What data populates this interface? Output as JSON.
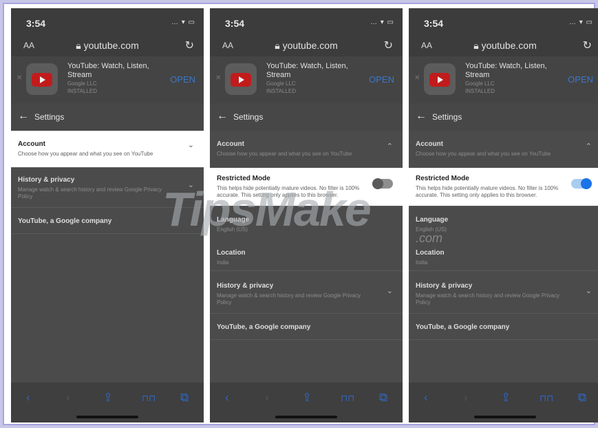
{
  "screens": [
    {
      "status": {
        "time": "3:54",
        "icons": "… ▾ ▭"
      },
      "browser": {
        "text_size": "AA",
        "url": "youtube.com",
        "reload_glyph": "↻"
      },
      "banner": {
        "title": "YouTube: Watch, Listen, Stream",
        "developer": "Google LLC",
        "status": "INSTALLED",
        "open_label": "OPEN"
      },
      "settings": {
        "back_glyph": "←",
        "title": "Settings"
      },
      "rows": {
        "account": {
          "title": "Account",
          "subtitle": "Choose how you appear and what you see on YouTube",
          "chevron": "⌄"
        },
        "history": {
          "title": "History & privacy",
          "subtitle": "Manage watch & search history and review Google Privacy Policy",
          "chevron": "⌄"
        },
        "company": {
          "title": "YouTube, a Google company"
        }
      },
      "toolbar": {
        "back": "‹",
        "forward": "›",
        "share": "⇪",
        "bookmarks": "⊓⊓",
        "tabs": "⧉"
      }
    },
    {
      "status": {
        "time": "3:54",
        "icons": "… ▾ ▭"
      },
      "browser": {
        "text_size": "AA",
        "url": "youtube.com",
        "reload_glyph": "↻"
      },
      "banner": {
        "title": "YouTube: Watch, Listen, Stream",
        "developer": "Google LLC",
        "status": "INSTALLED",
        "open_label": "OPEN"
      },
      "settings": {
        "back_glyph": "←",
        "title": "Settings"
      },
      "rows": {
        "account": {
          "title": "Account",
          "subtitle": "Choose how you appear and what you see on YouTube",
          "chevron": "⌃"
        },
        "restricted": {
          "title": "Restricted Mode",
          "subtitle": "This helps hide potentially mature videos. No filter is 100% accurate. This setting only applies to this browser.",
          "enabled": false
        },
        "language": {
          "title": "Language",
          "value": "English (US)"
        },
        "location": {
          "title": "Location",
          "value": "India"
        },
        "history": {
          "title": "History & privacy",
          "subtitle": "Manage watch & search history and review Google Privacy Policy",
          "chevron": "⌄"
        },
        "company": {
          "title": "YouTube, a Google company"
        }
      },
      "toolbar": {
        "back": "‹",
        "forward": "›",
        "share": "⇪",
        "bookmarks": "⊓⊓",
        "tabs": "⧉"
      }
    },
    {
      "status": {
        "time": "3:54",
        "icons": "… ▾ ▭"
      },
      "browser": {
        "text_size": "AA",
        "url": "youtube.com",
        "reload_glyph": "↻"
      },
      "banner": {
        "title": "YouTube: Watch, Listen, Stream",
        "developer": "Google LLC",
        "status": "INSTALLED",
        "open_label": "OPEN"
      },
      "settings": {
        "back_glyph": "←",
        "title": "Settings"
      },
      "rows": {
        "account": {
          "title": "Account",
          "subtitle": "Choose how you appear and what you see on YouTube",
          "chevron": "⌃"
        },
        "restricted": {
          "title": "Restricted Mode",
          "subtitle": "This helps hide potentially mature videos. No filter is 100% accurate. This setting only applies to this browser.",
          "enabled": true
        },
        "language": {
          "title": "Language",
          "value": "English (US)"
        },
        "location": {
          "title": "Location",
          "value": "India"
        },
        "history": {
          "title": "History & privacy",
          "subtitle": "Manage watch & search history and review Google Privacy Policy",
          "chevron": "⌄"
        },
        "company": {
          "title": "YouTube, a Google company"
        }
      },
      "toolbar": {
        "back": "‹",
        "forward": "›",
        "share": "⇪",
        "bookmarks": "⊓⊓",
        "tabs": "⧉"
      }
    }
  ],
  "watermark": {
    "text": "TipsMake",
    "suffix": ".com"
  },
  "colors": {
    "accent_blue": "#1a73e8",
    "open_link": "#3a78c8",
    "youtube_red": "#c21b1b",
    "frame_border": "#a7a4e0"
  }
}
